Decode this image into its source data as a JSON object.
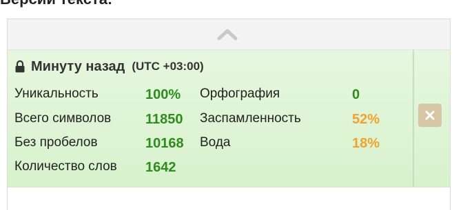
{
  "section": {
    "title": "Версии текста:"
  },
  "version": {
    "time": "Минуту назад",
    "timezone": "(UTC +03:00)",
    "stats_left": [
      {
        "label": "Уникальность",
        "value": "100%",
        "color": "#2e8b1f"
      },
      {
        "label": "Всего символов",
        "value": "11850",
        "color": "#2e8b1f"
      },
      {
        "label": "Без пробелов",
        "value": "10168",
        "color": "#2e8b1f"
      },
      {
        "label": "Количество слов",
        "value": "1642",
        "color": "#2e8b1f"
      }
    ],
    "stats_right": [
      {
        "label": "Орфография",
        "value": "0",
        "color": "#2e8b1f"
      },
      {
        "label": "Заспамленность",
        "value": "52%",
        "color": "#f0a22d"
      },
      {
        "label": "Вода",
        "value": "18%",
        "color": "#f0a22d"
      }
    ]
  },
  "icons": {
    "collapse": "chevron-up-icon",
    "lock": "lock-icon",
    "delete": "close-icon"
  }
}
